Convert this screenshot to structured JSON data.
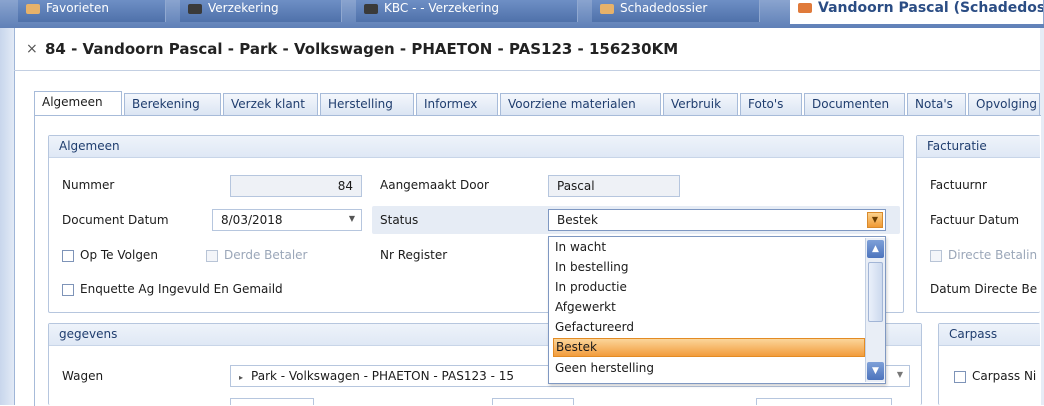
{
  "window_tabs": [
    {
      "label": "Favorieten"
    },
    {
      "label": "Verzekering"
    },
    {
      "label": "KBC - - Verzekering"
    },
    {
      "label": "Schadedossier"
    },
    {
      "label": "Vandoorn Pascal (Schadedossier)"
    }
  ],
  "document": {
    "close_glyph": "×",
    "title": "84 - Vandoorn Pascal - Park - Volkswagen - PHAETON - PAS123 - 156230KM"
  },
  "form_tabs": [
    "Algemeen",
    "Berekening",
    "Verzek klant",
    "Herstelling",
    "Informex",
    "Voorziene materialen",
    "Verbruik",
    "Foto's",
    "Documenten",
    "Nota's",
    "Opvolging"
  ],
  "algemeen": {
    "header": "Algemeen",
    "nummer_label": "Nummer",
    "nummer_value": "84",
    "aangemaakt_label": "Aangemaakt Door",
    "aangemaakt_value": "Pascal",
    "document_datum_label": "Document Datum",
    "document_datum_value": "8/03/2018",
    "status_label": "Status",
    "status_value": "Bestek",
    "op_te_volgen_label": "Op Te Volgen",
    "derde_betaler_label": "Derde Betaler",
    "nr_register_label": "Nr Register",
    "enquette_label": "Enquette Ag Ingevuld En Gemaild"
  },
  "facturatie": {
    "header": "Facturatie",
    "factuurnr_label": "Factuurnr",
    "factuur_datum_label": "Factuur Datum",
    "directe_betaling_label": "Directe Betalin",
    "datum_directe_label": "Datum Directe Be"
  },
  "gegevens": {
    "header": "gegevens",
    "wagen_label": "Wagen",
    "wagen_value": "Park - Volkswagen - PHAETON - PAS123 - 15"
  },
  "carpass": {
    "header": "Carpass",
    "carpass_label": "Carpass Ni"
  },
  "status_dropdown": {
    "options": [
      "In wacht",
      "In bestelling",
      "In productie",
      "Afgewerkt",
      "Gefactureerd",
      "Bestek",
      "Geen herstelling"
    ],
    "selected_index": 5
  },
  "colors": {
    "accent": "#f29c3c",
    "header_blue": "#5f80b7",
    "tab_text": "#1f3d6e"
  }
}
